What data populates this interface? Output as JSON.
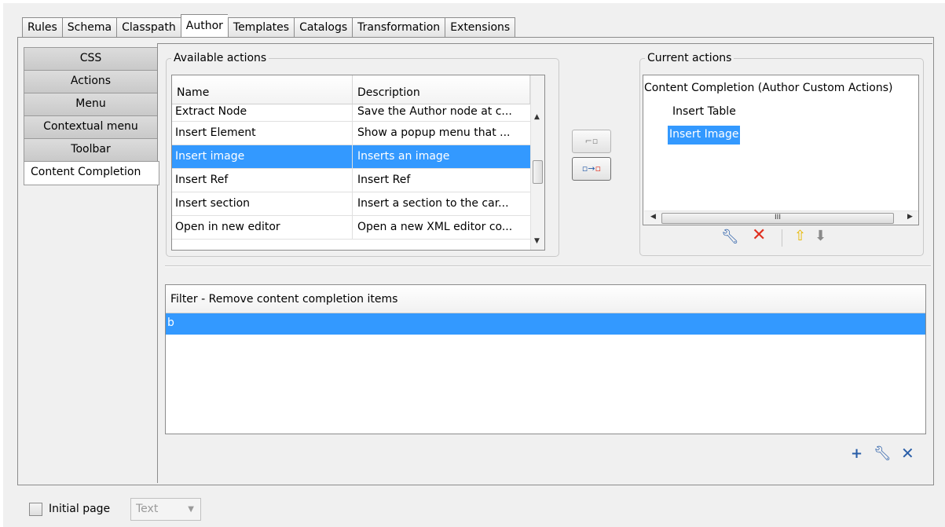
{
  "top_tabs": [
    "Rules",
    "Schema",
    "Classpath",
    "Author",
    "Templates",
    "Catalogs",
    "Transformation",
    "Extensions"
  ],
  "active_top_tab": "Author",
  "left_tabs": [
    "CSS",
    "Actions",
    "Menu",
    "Contextual menu",
    "Toolbar",
    "Content Completion"
  ],
  "active_left_tab": "Content Completion",
  "available_actions": {
    "legend": "Available actions",
    "columns": [
      "Name",
      "Description"
    ],
    "rows": [
      {
        "name": "Extract Node",
        "description": "Save the Author node at c..."
      },
      {
        "name": "Insert Element",
        "description": "Show a popup menu that ..."
      },
      {
        "name": "Insert image",
        "description": "Inserts an image"
      },
      {
        "name": "Insert Ref",
        "description": "Insert Ref"
      },
      {
        "name": "Insert section",
        "description": "Insert a section to the car..."
      },
      {
        "name": "Open in new editor",
        "description": "Open a new XML editor co..."
      }
    ],
    "selected_row": 2
  },
  "current_actions": {
    "legend": "Current actions",
    "root": "Content Completion (Author Custom Actions)",
    "items": [
      "Insert Table",
      "Insert Image"
    ],
    "selected_item": 1,
    "hscroll_grip": "III"
  },
  "filter": {
    "header": "Filter - Remove content completion items",
    "rows": [
      "b"
    ]
  },
  "bottom": {
    "initial_page_label": "Initial page",
    "initial_page_checked": false,
    "select_value": "Text"
  },
  "colors": {
    "selection": "#3399ff",
    "remove_red": "#e03020",
    "up_arrow": "#f0c020",
    "icon_blue": "#2a5ea8"
  }
}
